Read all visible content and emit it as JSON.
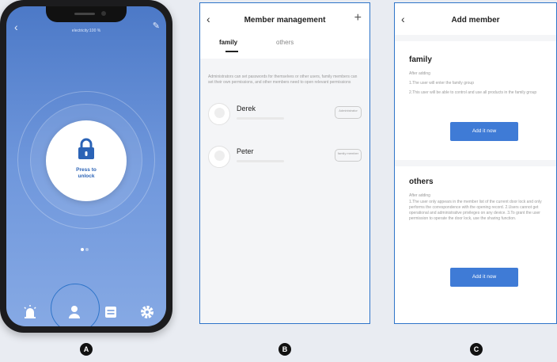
{
  "phone_a": {
    "electricity": "electricity:100 %",
    "unlock_label_line1": "Press to",
    "unlock_label_line2": "unlock",
    "tabs": [
      "alarm-icon",
      "user-icon",
      "list-icon",
      "gear-icon"
    ],
    "accent": "#4c79c7"
  },
  "screen_b": {
    "title": "Member management",
    "tabs": {
      "active": "family",
      "inactive": "others"
    },
    "note": "Administrators can set passwords for themselves or other users, family members can set their own permissions, and other members need to open relevant permissions",
    "members": [
      {
        "name": "Derek",
        "badge": "Administrator"
      },
      {
        "name": "Peter",
        "badge": "family member"
      }
    ]
  },
  "screen_c": {
    "title": "Add member",
    "family": {
      "heading": "family",
      "subheading": "After adding",
      "line1": "1.The user will enter the family group",
      "line2": "2.This user will be able to control and use all products in the family group",
      "button": "Add it now"
    },
    "others": {
      "heading": "others",
      "subheading": "After adding",
      "text": "1.The user only appears in the member list of the current door lock and only performs the correspondence with the opening record. 2.Users cannot get operational and administrative privileges on any device. 3.To grant the user permission to operate the door lock, use the sharing function.",
      "button": "Add it now"
    }
  },
  "labels": [
    "A",
    "B",
    "C"
  ]
}
